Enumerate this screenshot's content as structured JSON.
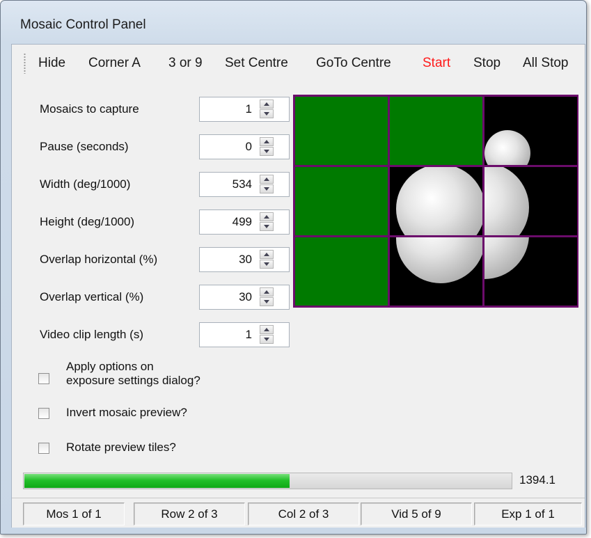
{
  "window": {
    "title": "Mosaic Control Panel"
  },
  "menu": [
    {
      "label": "Hide"
    },
    {
      "label": "Corner A"
    },
    {
      "label": "3 or 9"
    },
    {
      "label": "Set Centre"
    },
    {
      "label": "GoTo Centre"
    },
    {
      "label": "Start",
      "color": "#ff1a1a"
    },
    {
      "label": "Stop"
    },
    {
      "label": "All Stop"
    }
  ],
  "fields": [
    {
      "label": "Mosaics to capture",
      "value": "1"
    },
    {
      "label": "Pause (seconds)",
      "value": "0"
    },
    {
      "label": "Width (deg/1000)",
      "value": "534"
    },
    {
      "label": "Height (deg/1000)",
      "value": "499"
    },
    {
      "label": "Overlap horizontal (%)",
      "value": "30"
    },
    {
      "label": "Overlap vertical (%)",
      "value": "30"
    },
    {
      "label": "Video clip length (s)",
      "value": "1"
    }
  ],
  "options": [
    {
      "label_line1": "Apply options on",
      "label_line2": "exposure settings dialog?",
      "checked": false
    },
    {
      "label": "Invert mosaic preview?",
      "checked": false
    },
    {
      "label": "Rotate preview tiles?",
      "checked": false
    }
  ],
  "preview": {
    "grid_color": "#6b0c6b",
    "tile_states": [
      "captured",
      "captured",
      "image",
      "captured",
      "image",
      "image",
      "captured",
      "image",
      "image"
    ],
    "captured_color": "#007a00"
  },
  "progress": {
    "fraction": 0.545,
    "value_text": "1394.1"
  },
  "status": [
    "Mos 1 of 1",
    "Row 2 of 3",
    "Col 2 of 3",
    "Vid 5 of 9",
    "Exp 1 of 1"
  ]
}
